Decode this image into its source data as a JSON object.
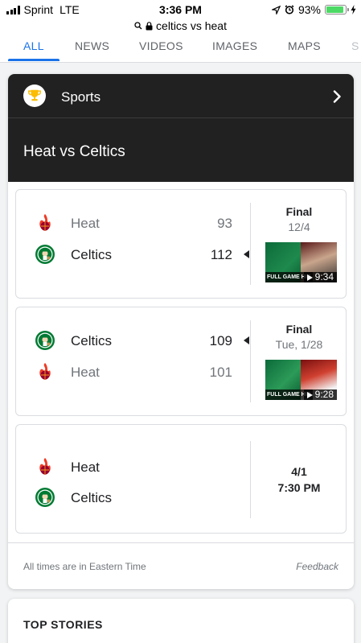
{
  "status_bar": {
    "carrier": "Sprint",
    "network": "LTE",
    "time": "3:36 PM",
    "battery": "93%",
    "battery_level": 0.93
  },
  "url_bar": {
    "query": "celtics vs heat"
  },
  "tabs": [
    {
      "label": "ALL",
      "active": true
    },
    {
      "label": "NEWS",
      "active": false
    },
    {
      "label": "VIDEOS",
      "active": false
    },
    {
      "label": "IMAGES",
      "active": false
    },
    {
      "label": "MAPS",
      "active": false
    },
    {
      "label": "S",
      "active": false
    }
  ],
  "sports_card": {
    "header": "Sports",
    "title": "Heat vs Celtics",
    "games": [
      {
        "teams": [
          {
            "name": "Heat",
            "score": "93",
            "logo": "heat-logo",
            "winner": false
          },
          {
            "name": "Celtics",
            "score": "112",
            "logo": "celtics-logo",
            "winner": true
          }
        ],
        "status": "Final",
        "date": "12/4",
        "video": {
          "label": "FULL GAME HIG",
          "duration": "9:34"
        }
      },
      {
        "teams": [
          {
            "name": "Celtics",
            "score": "109",
            "logo": "celtics-logo",
            "winner": true
          },
          {
            "name": "Heat",
            "score": "101",
            "logo": "heat-logo",
            "winner": false
          }
        ],
        "status": "Final",
        "date": "Tue, 1/28",
        "video": {
          "label": "FULL GAME HIG",
          "duration": "9:28"
        }
      },
      {
        "teams": [
          {
            "name": "Heat",
            "logo": "heat-logo"
          },
          {
            "name": "Celtics",
            "logo": "celtics-logo"
          }
        ],
        "date": "4/1",
        "time": "7:30 PM"
      }
    ],
    "footer_note": "All times are in Eastern Time",
    "feedback": "Feedback"
  },
  "top_stories": {
    "title": "TOP STORIES"
  },
  "colors": {
    "accent": "#1a73e8",
    "header_bg": "#212121",
    "heat_red": "#98002e",
    "celtics_green": "#007a33"
  }
}
